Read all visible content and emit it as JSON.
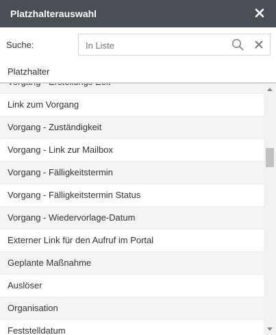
{
  "dialog": {
    "title": "Platzhalterauswahl",
    "close_icon": "close-icon"
  },
  "search": {
    "label": "Suche:",
    "placeholder": "In Liste",
    "search_icon": "magnifier-icon",
    "clear_icon": "close-icon"
  },
  "section": {
    "title": "Platzhalter"
  },
  "list": {
    "items": [
      "Vorgang - Erstellungs-Zeit",
      "Link zum Vorgang",
      "Vorgang - Zuständigkeit",
      "Vorgang - Link zur Mailbox",
      "Vorgang - Fälligkeitstermin",
      "Vorgang - Fälligkeitstermin Status",
      "Vorgang - Wiedervorlage-Datum",
      "Externer Link für den Aufruf im Portal",
      "Geplante Maßnahme",
      "Auslöser",
      "Organisation",
      "Feststelldatum"
    ]
  },
  "scrollbar": {
    "position_fraction": 0.3
  },
  "colors": {
    "titlebar": "#4a4f55",
    "row_alt": "#f4f4f4"
  }
}
